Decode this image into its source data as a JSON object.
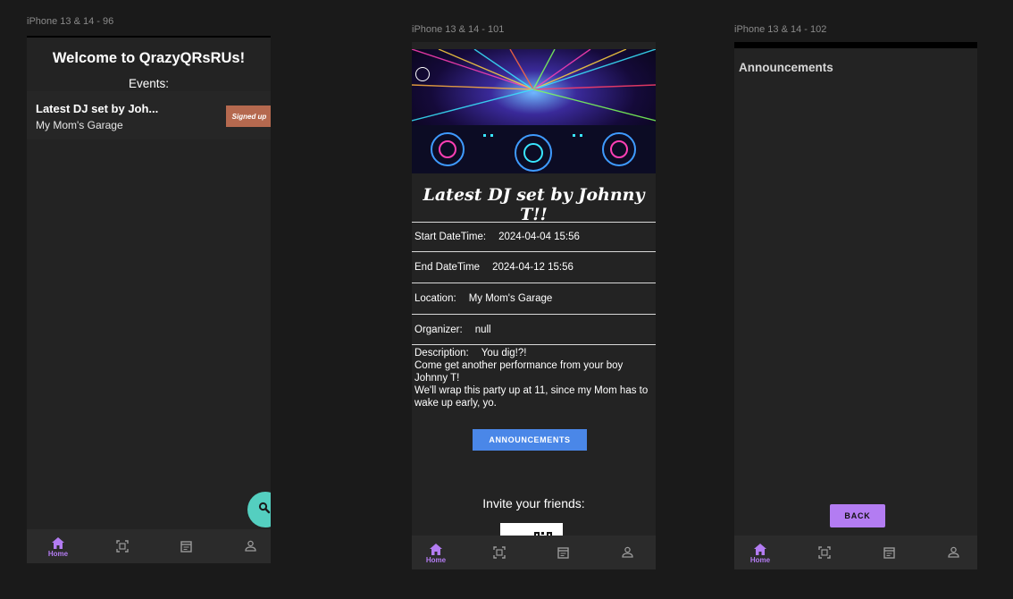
{
  "frames": [
    {
      "label": "iPhone 13 & 14 - 96"
    },
    {
      "label": "iPhone 13 & 14 - 101"
    },
    {
      "label": "iPhone 13 & 14 - 102"
    }
  ],
  "home": {
    "title": "Welcome to QrazyQRsRUs!",
    "subtitle": "Events:",
    "event": {
      "title": "Latest DJ set by Joh...",
      "location": "My Mom's Garage",
      "badge": "Signed up"
    },
    "fab_icon": "search-icon"
  },
  "nav": {
    "items": [
      {
        "icon": "home-icon",
        "label": "Home"
      },
      {
        "icon": "qr-scan-icon",
        "label": ""
      },
      {
        "icon": "calendar-icon",
        "label": ""
      },
      {
        "icon": "profile-icon",
        "label": ""
      }
    ],
    "active_color": "#b37cf2"
  },
  "details": {
    "event_title": "Latest DJ set by Johnny T!!",
    "start_label": "Start DateTime:",
    "start_value": "2024-04-04 15:56",
    "end_label": "End DateTime",
    "end_value": "2024-04-12 15:56",
    "location_label": "Location:",
    "location_value": "My Mom's Garage",
    "organizer_label": "Organizer:",
    "organizer_value": "null",
    "description_label": "Description:",
    "description_line1": "You dig!?!",
    "description_line2": "Come get another performance from your boy Johnny T!",
    "description_line3": "We'll wrap this party up at 11, since my Mom has to wake up early, yo.",
    "announcements_button": "ANNOUNCEMENTS",
    "invite_text": "Invite your friends:"
  },
  "announcements": {
    "title": "Announcements",
    "back_button": "BACK"
  },
  "colors": {
    "background": "#1a1a1a",
    "screen": "#232323",
    "badge": "#b5694f",
    "fab": "#54cfc0",
    "primary_button": "#4a87e8",
    "accent": "#b37cf2"
  }
}
